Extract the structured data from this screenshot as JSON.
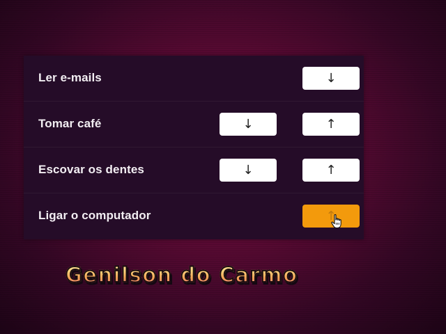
{
  "tasks": [
    {
      "label": "Ler e-mails",
      "down_label": "",
      "up_label": "↓"
    },
    {
      "label": "Tomar café",
      "down_label": "↓",
      "up_label": "↑"
    },
    {
      "label": "Escovar os dentes",
      "down_label": "↓",
      "up_label": "↑"
    },
    {
      "label": "Ligar o computador",
      "down_label": "",
      "up_label": "↑"
    }
  ],
  "highlight_color": "#f39a0c",
  "panel_color": "#250c28",
  "signature": "Genilson do Carmo"
}
